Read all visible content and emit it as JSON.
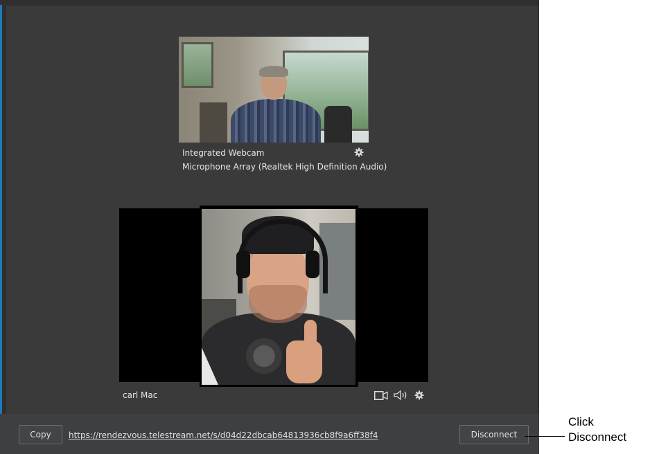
{
  "local": {
    "camera_name": "Integrated Webcam",
    "microphone_name": "Microphone Array (Realtek High Definition Audio)",
    "settings_icon": "gear-icon"
  },
  "remote": {
    "name": "carl Mac",
    "icons": [
      "video-camera-icon",
      "speaker-icon",
      "gear-icon"
    ]
  },
  "bottom_bar": {
    "copy_label": "Copy",
    "link_url": "https://rendezvous.telestream.net/s/d04d22dbcab64813936cb8f9a6ff38f4",
    "disconnect_label": "Disconnect"
  },
  "callout": {
    "line1": "Click",
    "line2": "Disconnect"
  },
  "colors": {
    "panel_bg": "#3a3a3b",
    "frame_bg": "#2f2f2f",
    "accent_edge": "#1d7ab8",
    "text": "#e6e6e6"
  }
}
